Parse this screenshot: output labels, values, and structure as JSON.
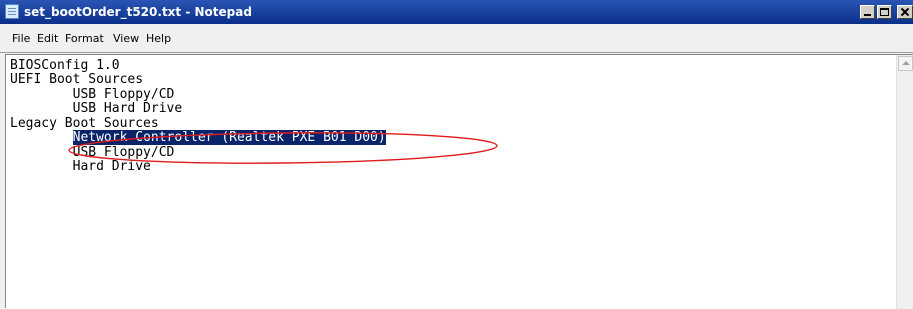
{
  "window": {
    "title": "set_bootOrder_t520.txt - Notepad"
  },
  "menu": {
    "items": [
      "File",
      "Edit",
      "Format",
      "View",
      "Help"
    ]
  },
  "editor": {
    "lines": [
      "BIOSConfig 1.0",
      "UEFI Boot Sources",
      "        USB Floppy/CD",
      "        USB Hard Drive",
      "Legacy Boot Sources",
      "        Network Controller (Realtek PXE B01 D00)",
      "        USB Floppy/CD",
      "        Hard Drive"
    ],
    "selected_text": "Network Controller (Realtek PXE B01 D00)"
  },
  "annotation": {
    "color": "#e11b1b",
    "type": "ellipse"
  },
  "icons": {
    "app": "notepad-icon",
    "minimize": "minimize-icon",
    "maximize": "maximize-icon",
    "close": "close-icon",
    "scroll_up": "arrow-up-icon"
  }
}
